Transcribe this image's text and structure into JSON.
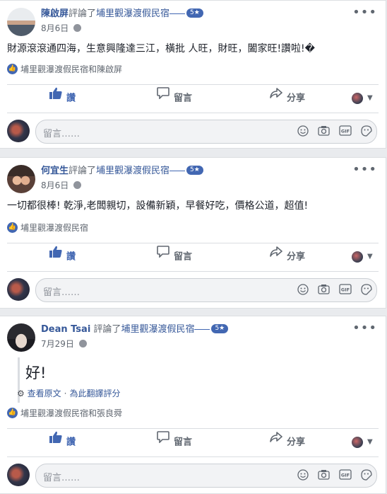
{
  "posts": [
    {
      "author": "陳啟屏",
      "action_text": "評論了",
      "page": "埔里觀瀑渡假民宿",
      "rating_badge": "5★",
      "date": "8月6日",
      "review": "財源滾滾通四海，生意興隆達三江，橫批 人旺，財旺，闔家旺!讚啦!�",
      "likes": "埔里觀瀑渡假民宿和陳啟屏"
    },
    {
      "author": "何宜生",
      "action_text": "評論了",
      "page": "埔里觀瀑渡假民宿",
      "rating_badge": "5★",
      "date": "8月6日",
      "review": "一切都很棒! 乾淨,老闆親切，設備新穎，早餐好吃，價格公道，超值!",
      "likes": "埔里觀瀑渡假民宿"
    },
    {
      "author": "Dean Tsai",
      "action_text": "評論了",
      "page": "埔里觀瀑渡假民宿",
      "rating_badge": "5★",
      "date": "7月29日",
      "review": "好!",
      "see_original": "查看原文",
      "rate_translation": "為此翻譯評分",
      "likes": "埔里觀瀑渡假民宿和張良舜"
    }
  ],
  "actions": {
    "like": "讚",
    "comment": "留言",
    "share": "分享"
  },
  "comment_placeholder": "留言……",
  "more_glyph": "•••",
  "colors": {
    "link": "#365899",
    "accent": "#4267b2",
    "muted": "#606770",
    "background": "#e9ebee"
  }
}
